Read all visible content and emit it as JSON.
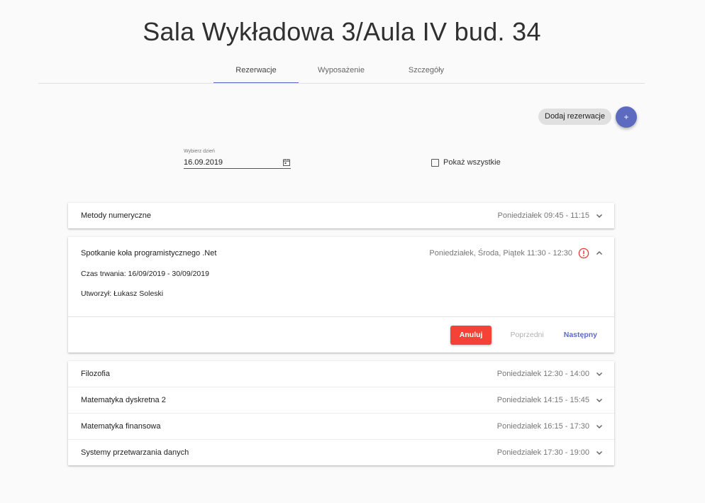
{
  "page": {
    "title": "Sala Wykładowa 3/Aula IV bud. 34"
  },
  "tabs": [
    {
      "label": "Rezerwacje",
      "active": true
    },
    {
      "label": "Wyposażenie",
      "active": false
    },
    {
      "label": "Szczegóły",
      "active": false
    }
  ],
  "actions": {
    "add_label": "Dodaj rezerwacje",
    "add_button": "+"
  },
  "date_picker": {
    "label": "Wybierz dzień",
    "value": "16.09.2019",
    "icon": "calendar-icon"
  },
  "show_all": {
    "label": "Pokaż wszystkie",
    "checked": false
  },
  "reservations": [
    {
      "title": "Metody numeryczne",
      "time": "Poniedziałek 09:45 - 11:15",
      "expanded": false
    },
    {
      "title": "Spotkanie koła programistycznego .Net",
      "time": "Poniedziałek, Środa, Piątek 11:30 - 12:30",
      "expanded": true,
      "warning": true,
      "duration": "Czas trwania: 16/09/2019 - 30/09/2019",
      "created_by": "Utworzył: Łukasz Soleski",
      "buttons": {
        "cancel": "Anuluj",
        "previous": "Poprzedni",
        "next": "Następny"
      }
    },
    {
      "title": "Filozofia",
      "time": "Poniedziałek 12:30 - 14:00",
      "expanded": false
    },
    {
      "title": "Matematyka dyskretna 2",
      "time": "Poniedziałek 14:15 - 15:45",
      "expanded": false
    },
    {
      "title": "Matematyka finansowa",
      "time": "Poniedziałek 16:15 - 17:30",
      "expanded": false
    },
    {
      "title": "Systemy przetwarzania danych",
      "time": "Poniedziałek 17:30 - 19:00",
      "expanded": false
    }
  ],
  "colors": {
    "primary": "#5c6bc0",
    "warn": "#f44336",
    "background": "#fafafa"
  }
}
